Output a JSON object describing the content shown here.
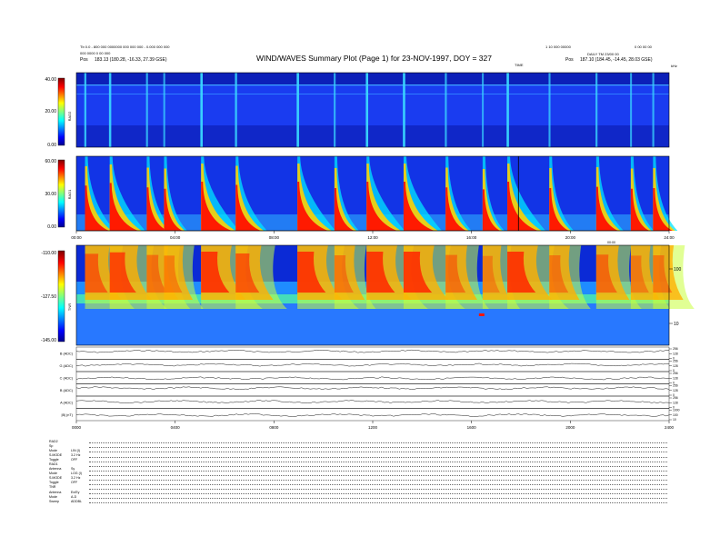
{
  "header": {
    "left_line1": "Tb 0.0 - 800 000 0000000 000 000 000 - 0.000 000 000",
    "left_line2": "000 0000 0 00 000",
    "left_pos_label": "Pos",
    "left_pos_value": "183.13 (180.28, -16.33, 27.39 GSE)",
    "title": "WIND/WAVES Summary Plot (Page 1) for 23-NOV-1997, DOY = 327",
    "right_line1": "1 10 000 00000",
    "right_line2": "0 00 00 00",
    "right_line3": "DAILY  TM 23/00 00",
    "right_pos_label": "Pos",
    "right_pos_value": "187.10 (184.45, -14.45, 28.03 GSE)",
    "right_mini": "TIME"
  },
  "chart_data": [
    {
      "type": "heatmap",
      "name": "RAD2",
      "ylabel": "RAD2",
      "colorbar_ticks": [
        "40.00",
        "20.00",
        "0.00"
      ],
      "colorbar_range": [
        0,
        40
      ]
    },
    {
      "type": "heatmap",
      "name": "RAD1",
      "ylabel": "RAD1",
      "colorbar_ticks": [
        "60.00",
        "30.00",
        "0.00"
      ],
      "colorbar_range": [
        0,
        60
      ]
    },
    {
      "type": "heatmap",
      "name": "TNR",
      "ylabel": "TNR",
      "x_ticks": [
        "00:00",
        "04:00",
        "08:00",
        "12:00",
        "16:00",
        "20:00",
        "24:00"
      ],
      "colorbar_ticks": [
        "-110.00",
        "-127.50",
        "-145.00"
      ],
      "colorbar_range": [
        -145,
        -110
      ],
      "right_axis_ticks": [
        "100",
        "10"
      ],
      "right_axis_label": "kHz",
      "xlabel_right": "00:00"
    },
    {
      "type": "line",
      "name": "Magnetometer / electric field traces",
      "x_ticks": [
        "0000",
        "0400",
        "0800",
        "1200",
        "1600",
        "2000",
        "2400"
      ],
      "series": [
        {
          "name": "B (ADC)"
        },
        {
          "name": "G (ADC)"
        },
        {
          "name": "C (ADC)"
        },
        {
          "name": "B (ADC)"
        },
        {
          "name": "A (ADC)"
        },
        {
          "name": "|B| (nT)"
        }
      ],
      "right_ticks": [
        [
          "256",
          "128",
          "0"
        ],
        [
          "256",
          "128",
          "0"
        ],
        [
          "256",
          "128",
          "0"
        ],
        [
          "256",
          "128",
          "0"
        ],
        [
          "256",
          "128",
          "0"
        ],
        [
          "1000",
          "100",
          "10"
        ]
      ]
    }
  ],
  "bursts": [
    {
      "t": 0.35,
      "strength": 0.7
    },
    {
      "t": 1.35,
      "strength": 0.9
    },
    {
      "t": 2.85,
      "strength": 0.55
    },
    {
      "t": 3.55,
      "strength": 0.45
    },
    {
      "t": 5.05,
      "strength": 1.0
    },
    {
      "t": 6.45,
      "strength": 0.75
    },
    {
      "t": 8.95,
      "strength": 1.0
    },
    {
      "t": 10.45,
      "strength": 0.5
    },
    {
      "t": 11.75,
      "strength": 1.0
    },
    {
      "t": 13.25,
      "strength": 1.0
    },
    {
      "t": 14.95,
      "strength": 0.55
    },
    {
      "t": 16.45,
      "strength": 0.4
    },
    {
      "t": 17.45,
      "strength": 1.0
    },
    {
      "t": 19.15,
      "strength": 0.5
    },
    {
      "t": 21.05,
      "strength": 0.6
    },
    {
      "t": 22.45,
      "strength": 0.45
    },
    {
      "t": 23.35,
      "strength": 0.5
    }
  ],
  "footer": {
    "rows": [
      {
        "label": "RAD2",
        "value": ""
      },
      {
        "label": "Sp",
        "value": ""
      },
      {
        "label": "Mode",
        "value": "LIN (I)"
      },
      {
        "label": "S.MODE",
        "value": "3.2 Hz"
      },
      {
        "label": "Toggle",
        "value": "OFF"
      },
      {
        "label": "RAD1",
        "value": ""
      },
      {
        "label": "Antenna",
        "value": "Sy"
      },
      {
        "label": "Mode",
        "value": "LOG (I)"
      },
      {
        "label": "S.MODE",
        "value": "3.2 Hz"
      },
      {
        "label": "Toggle",
        "value": "OFF"
      },
      {
        "label": "TNR",
        "value": ""
      },
      {
        "label": "Antenna",
        "value": "Ex/Ey"
      },
      {
        "label": "Mode",
        "value": "A-D"
      },
      {
        "label": "Sweep",
        "value": "ADDBL"
      }
    ]
  }
}
